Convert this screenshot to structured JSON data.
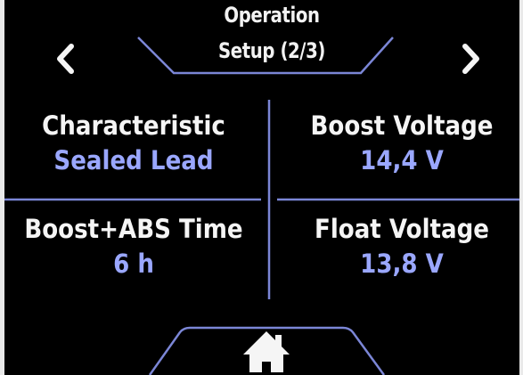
{
  "header": {
    "title_line1": "Operation",
    "title_line2": "Setup (2/3)"
  },
  "settings": [
    {
      "label": "Characteristic",
      "value": "Sealed Lead"
    },
    {
      "label": "Boost Voltage",
      "value": "14,4 V"
    },
    {
      "label": "Boost+ABS Time",
      "value": "6 h"
    },
    {
      "label": "Float Voltage",
      "value": "13,8 V"
    }
  ],
  "icons": {
    "prev": "chevron-left-icon",
    "next": "chevron-right-icon",
    "home": "home-icon"
  },
  "colors": {
    "background": "#000000",
    "label": "#f5f5f5",
    "value": "#9aa7ff",
    "divider": "#7b86d6"
  }
}
